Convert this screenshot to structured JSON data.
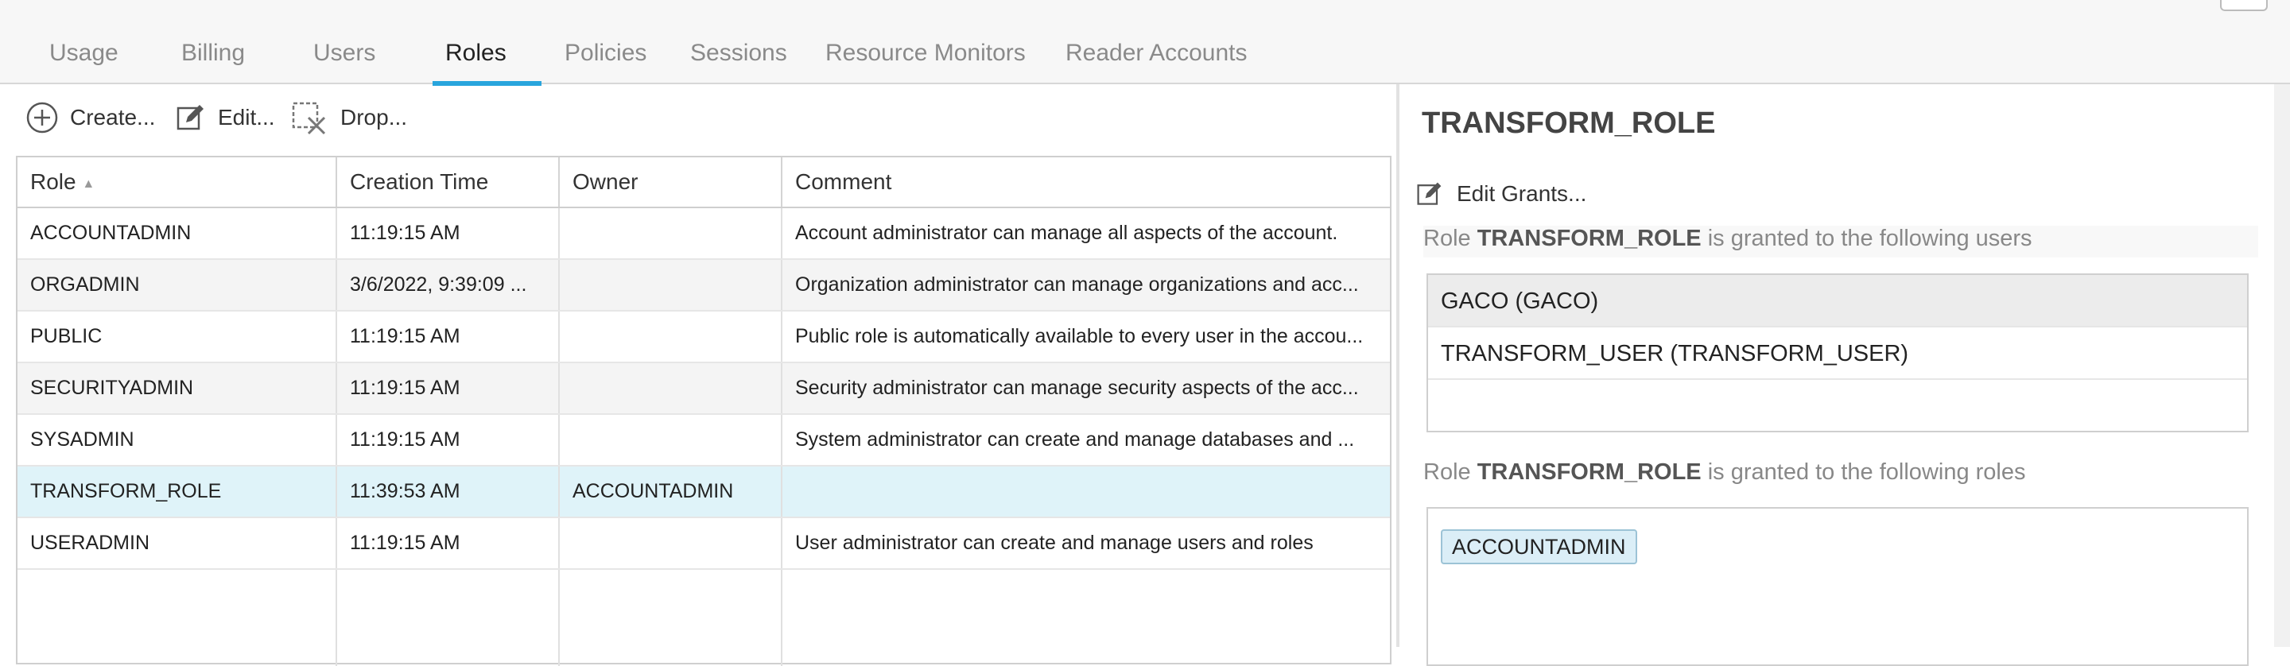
{
  "tabs": [
    {
      "label": "Usage"
    },
    {
      "label": "Billing"
    },
    {
      "label": "Users"
    },
    {
      "label": "Roles"
    },
    {
      "label": "Policies"
    },
    {
      "label": "Sessions"
    },
    {
      "label": "Resource Monitors"
    },
    {
      "label": "Reader Accounts"
    }
  ],
  "active_tab": "Roles",
  "toolbar": {
    "create_label": "Create...",
    "edit_label": "Edit...",
    "drop_label": "Drop..."
  },
  "table": {
    "columns": [
      "Role",
      "Creation Time",
      "Owner",
      "Comment"
    ],
    "sort_indicator": "▲",
    "rows": [
      {
        "role": "ACCOUNTADMIN",
        "created": "11:19:15 AM",
        "owner": "",
        "comment": "Account administrator can manage all aspects of the account."
      },
      {
        "role": "ORGADMIN",
        "created": "3/6/2022, 9:39:09 ...",
        "owner": "",
        "comment": "Organization administrator can manage organizations and acc..."
      },
      {
        "role": "PUBLIC",
        "created": "11:19:15 AM",
        "owner": "",
        "comment": "Public role is automatically available to every user in the accou..."
      },
      {
        "role": "SECURITYADMIN",
        "created": "11:19:15 AM",
        "owner": "",
        "comment": "Security administrator can manage security aspects of the acc..."
      },
      {
        "role": "SYSADMIN",
        "created": "11:19:15 AM",
        "owner": "",
        "comment": "System administrator can create and manage databases and ..."
      },
      {
        "role": "TRANSFORM_ROLE",
        "created": "11:39:53 AM",
        "owner": "ACCOUNTADMIN",
        "comment": ""
      },
      {
        "role": "USERADMIN",
        "created": "11:19:15 AM",
        "owner": "",
        "comment": "User administrator can create and manage users and roles"
      }
    ],
    "selected_row": 5
  },
  "panel": {
    "title": "TRANSFORM_ROLE",
    "edit_grants_label": "Edit Grants...",
    "users_prefix": "Role ",
    "role_name": "TRANSFORM_ROLE",
    "users_suffix": " is granted to the following users",
    "users": [
      "GACO (GACO)",
      "TRANSFORM_USER (TRANSFORM_USER)"
    ],
    "roles_prefix": "Role ",
    "roles_suffix": " is granted to the following roles",
    "roles": [
      "ACCOUNTADMIN"
    ]
  },
  "colors": {
    "accent": "#29a5dd",
    "selected_row": "#dff3f9"
  }
}
